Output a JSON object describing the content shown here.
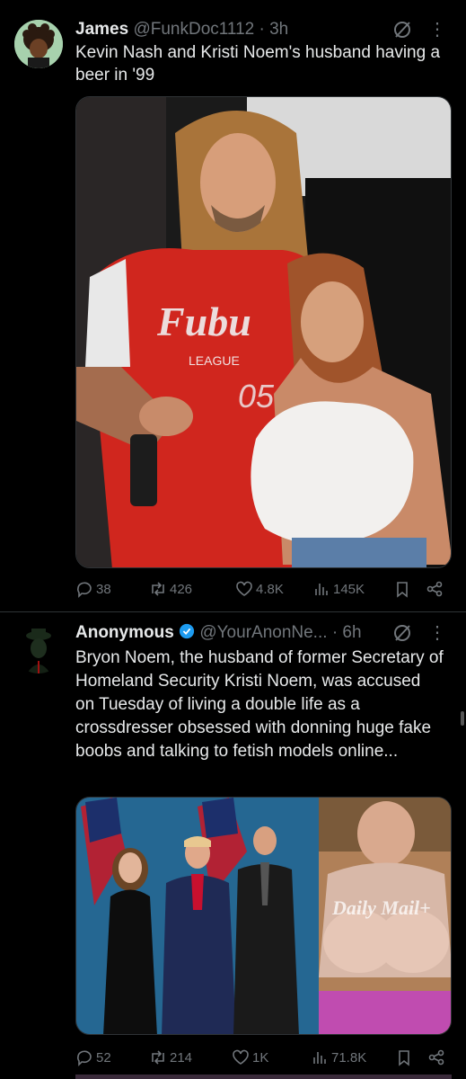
{
  "tweets": [
    {
      "name": "James",
      "handle": "@FunkDoc1112",
      "time": "· 3h",
      "text": "Kevin Nash and Kristi Noem's husband having a beer in '99",
      "media": {
        "shirt_logo": "Fubu",
        "shirt_sub": "LEAGUE",
        "shirt_num": "05"
      },
      "stats": {
        "replies": "38",
        "reposts": "426",
        "likes": "4.8K",
        "views": "145K"
      }
    },
    {
      "name": "Anonymous",
      "handle": "@YourAnonNe...",
      "time": "· 6h",
      "verified": true,
      "text": "Bryon Noem, the husband of former Secretary of Homeland Security Kristi Noem, was accused on Tuesday of living a double life as a crossdresser obsessed with donning huge fake boobs and talking to fetish models online...",
      "media": {
        "watermark": "Daily Mail+"
      },
      "stats": {
        "replies": "52",
        "reposts": "214",
        "likes": "1K",
        "views": "71.8K"
      }
    }
  ],
  "colors": {
    "bg": "#000000",
    "text": "#e7e9ea",
    "muted": "#71767b",
    "verified": "#1d9bf0",
    "divider": "#2f3336"
  }
}
